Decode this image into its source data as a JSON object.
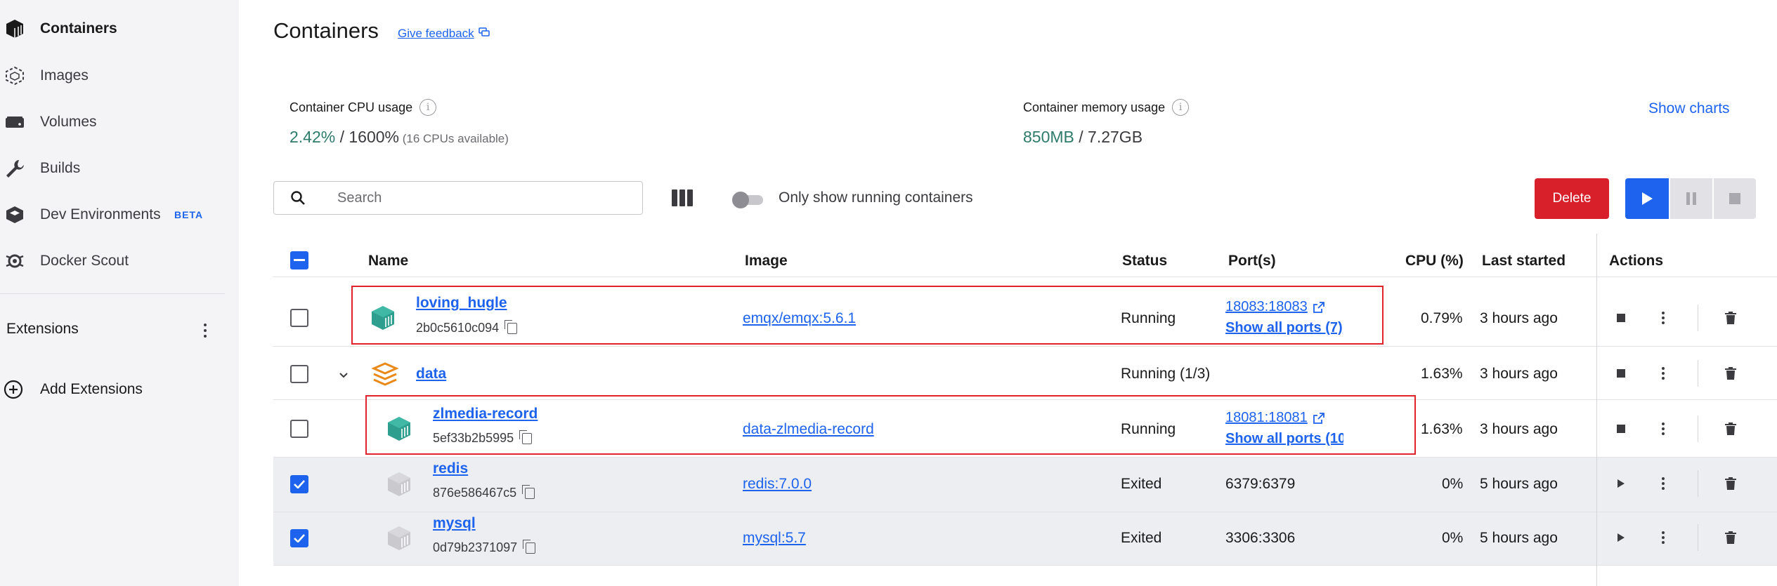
{
  "sidebar": {
    "items": [
      {
        "label": "Containers",
        "icon": "containers-icon",
        "active": true
      },
      {
        "label": "Images",
        "icon": "images-icon"
      },
      {
        "label": "Volumes",
        "icon": "volumes-icon"
      },
      {
        "label": "Builds",
        "icon": "wrench-icon"
      },
      {
        "label": "Dev Environments",
        "icon": "dev-environments-icon",
        "badge": "BETA"
      },
      {
        "label": "Docker Scout",
        "icon": "docker-scout-icon"
      }
    ],
    "extensions_label": "Extensions",
    "add_extensions_label": "Add Extensions"
  },
  "header": {
    "title": "Containers",
    "feedback_label": "Give feedback"
  },
  "stats": {
    "cpu_label": "Container CPU usage",
    "cpu_value": "2.42%",
    "cpu_total": " / 1600%",
    "cpu_note": " (16 CPUs available)",
    "memory_label": "Container memory usage",
    "memory_value": "850MB",
    "memory_total": " / 7.27GB",
    "show_charts_label": "Show charts"
  },
  "toolbar": {
    "search_placeholder": "Search",
    "running_only_label": "Only show running containers",
    "running_only_enabled": false,
    "delete_label": "Delete"
  },
  "table": {
    "columns": {
      "name": "Name",
      "image": "Image",
      "status": "Status",
      "ports": "Port(s)",
      "cpu": "CPU (%)",
      "last_started": "Last started",
      "actions": "Actions"
    },
    "rows": [
      {
        "name": "loving_hugle",
        "id": "2b0c5610c094",
        "image": "emqx/emqx:5.6.1",
        "status": "Running",
        "port": "18083:18083",
        "show_ports": "Show all ports (7)",
        "cpu": "0.79%",
        "last_started": "3 hours ago",
        "checked": false,
        "state": "running"
      },
      {
        "name": "data",
        "id": "",
        "image": "",
        "status": "Running (1/3)",
        "port": "",
        "show_ports": "",
        "cpu": "1.63%",
        "last_started": "3 hours ago",
        "checked": false,
        "state": "running",
        "group": true
      },
      {
        "name": "zlmedia-record",
        "id": "5ef33b2b5995",
        "image": "data-zlmedia-record",
        "status": "Running",
        "port": "18081:18081",
        "show_ports": "Show all ports (10",
        "cpu": "1.63%",
        "last_started": "3 hours ago",
        "checked": false,
        "state": "running"
      },
      {
        "name": "redis",
        "id": "876e586467c5",
        "image": "redis:7.0.0",
        "status": "Exited",
        "port": "6379:6379",
        "show_ports": "",
        "cpu": "0%",
        "last_started": "5 hours ago",
        "checked": true,
        "state": "exited"
      },
      {
        "name": "mysql",
        "id": "0d79b2371097",
        "image": "mysql:5.7",
        "status": "Exited",
        "port": "3306:3306",
        "show_ports": "",
        "cpu": "0%",
        "last_started": "5 hours ago",
        "checked": true,
        "state": "exited"
      }
    ]
  },
  "colors": {
    "accent": "#1d63ed",
    "danger": "#d8202a",
    "running_icon": "#2e9f8f",
    "exited_icon": "#c9c9ce",
    "group_icon": "#e98a1b",
    "highlight_box": "#e0232b"
  }
}
